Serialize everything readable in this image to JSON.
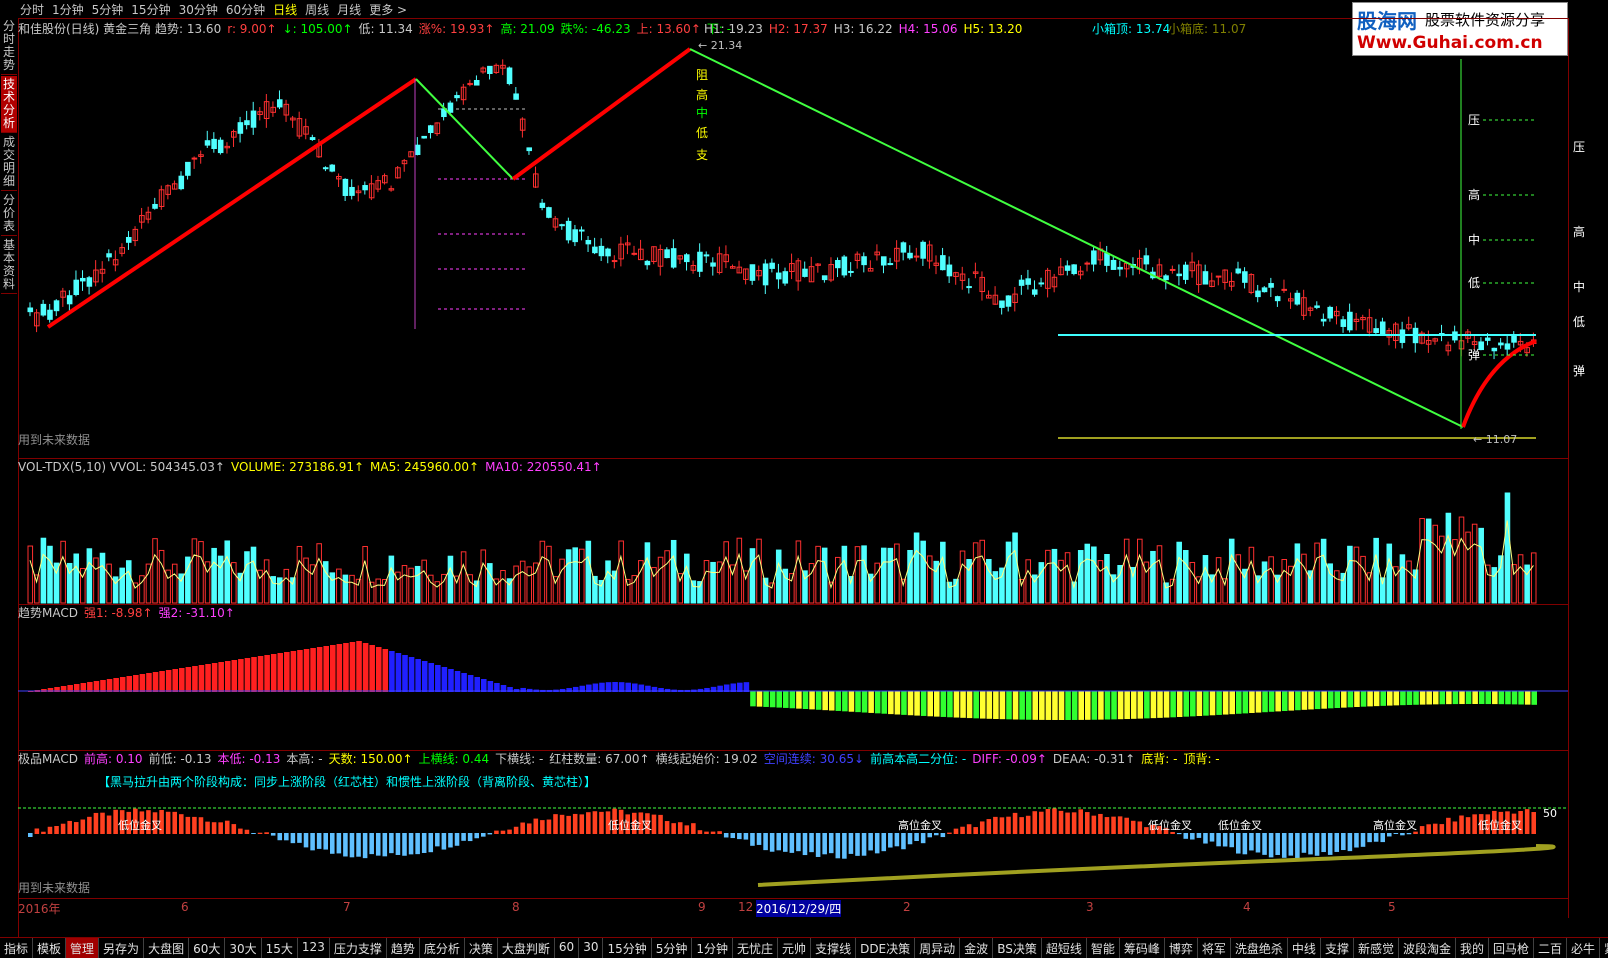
{
  "topbar": {
    "tabs": [
      "分时",
      "1分钟",
      "5分钟",
      "15分钟",
      "30分钟",
      "60分钟",
      "日线",
      "周线",
      "月线",
      "更多 >"
    ],
    "active_index": 6
  },
  "left_tabs": [
    "分时走势",
    "技术分析",
    "成交明细",
    "分价表",
    "基本资料"
  ],
  "left_active_index": 1,
  "logo": {
    "title": "股海网",
    "subtitle": "股票软件资源分享",
    "url": "Www.Guhai.com.cn"
  },
  "main": {
    "legend": [
      {
        "text": "和佳股份(日线) 黄金三角  趋势: 13.60",
        "color": "#c8c8c8"
      },
      {
        "text": "r: 9.00↑",
        "color": "#ff4040"
      },
      {
        "text": "↓: 105.00↑",
        "color": "#00ff00"
      },
      {
        "text": "低: 11.34",
        "color": "#c8c8c8"
      },
      {
        "text": "涨%: 19.93↑",
        "color": "#ff4040"
      },
      {
        "text": "高: 21.09",
        "color": "#00ff00"
      },
      {
        "text": "跌%: -46.23",
        "color": "#00ff00"
      },
      {
        "text": "上: 13.60↑",
        "color": "#ff4040"
      },
      {
        "text": "下: -",
        "color": "#00ff00"
      }
    ],
    "h_legend": [
      {
        "text": "H1: 19.23",
        "color": "#c8c8c8"
      },
      {
        "text": "H2: 17.37",
        "color": "#ff4040"
      },
      {
        "text": "H3: 16.22",
        "color": "#c8c8c8"
      },
      {
        "text": "H4: 15.06",
        "color": "#ff40ff"
      },
      {
        "text": "H5: 13.20",
        "color": "#ffff00"
      }
    ],
    "box_top": "小箱顶: 13.74",
    "box_bottom": "小箱底: 11.07",
    "peak_label": "21.34",
    "low_label": "11.07",
    "future_note": "用到未来数据",
    "level_labels_left": [
      "阻",
      "高",
      "中",
      "低",
      "支"
    ],
    "level_labels_right": [
      "压",
      "高",
      "中",
      "低",
      "弹"
    ]
  },
  "vol": {
    "legend": [
      {
        "text": "VOL-TDX(5,10)  VVOL: 504345.03↑",
        "color": "#c8c8c8"
      },
      {
        "text": "VOLUME: 273186.91↑",
        "color": "#ffff00"
      },
      {
        "text": "MA5: 245960.00↑",
        "color": "#ffff00"
      },
      {
        "text": "MA10: 220550.41↑",
        "color": "#ff40ff"
      }
    ]
  },
  "macd1": {
    "legend": [
      {
        "text": "趋势MACD",
        "color": "#c8c8c8"
      },
      {
        "text": "强1: -8.98↑",
        "color": "#ff4040"
      },
      {
        "text": "强2: -31.10↑",
        "color": "#ff40ff"
      }
    ]
  },
  "macd2": {
    "legend": [
      {
        "text": "极品MACD",
        "color": "#c8c8c8"
      },
      {
        "text": "前高: 0.10",
        "color": "#ff40ff"
      },
      {
        "text": "前低: -0.13",
        "color": "#c8c8c8"
      },
      {
        "text": "本低: -0.13",
        "color": "#ff40ff"
      },
      {
        "text": "本高: -",
        "color": "#c8c8c8"
      },
      {
        "text": "天数: 150.00↑",
        "color": "#ffff00"
      },
      {
        "text": "上横线: 0.44",
        "color": "#00ff00"
      },
      {
        "text": "下横线: -",
        "color": "#c8c8c8"
      },
      {
        "text": "红柱数量: 67.00↑",
        "color": "#c8c8c8"
      },
      {
        "text": "横线起始价: 19.02",
        "color": "#c8c8c8"
      },
      {
        "text": "空间连续: 30.65↓",
        "color": "#4040ff"
      },
      {
        "text": "前高本高二分位: -",
        "color": "#00ffff"
      },
      {
        "text": "DIFF: -0.09↑",
        "color": "#ff40ff"
      },
      {
        "text": "DEAA: -0.31↑",
        "color": "#c8c8c8"
      },
      {
        "text": "底背: -",
        "color": "#ffff00"
      },
      {
        "text": "顶背: -",
        "color": "#ffff00"
      }
    ],
    "banner": "【黑马拉升由两个阶段构成：同步上涨阶段（红芯柱）和惯性上涨阶段（背离阶段、黄芯柱）】",
    "annotations": [
      "低位金叉",
      "低位金叉",
      "高位金叉",
      "低位金叉",
      "低位金叉",
      "高位金叉",
      "低位金叉"
    ],
    "future_note": "用到未来数据",
    "right_value": "50"
  },
  "date_axis": {
    "labels": [
      "2016年",
      "6",
      "7",
      "8",
      "9",
      "12",
      "2016/12/29/四",
      "2",
      "3",
      "4",
      "5"
    ]
  },
  "right_scale": [
    "压",
    "高",
    "中",
    "低",
    "弹"
  ],
  "bottombar": [
    "指标",
    "模板",
    "管理",
    "另存为",
    "大盘图",
    "60大",
    "30大",
    "15大",
    "123",
    "压力支撑",
    "趋势",
    "底分析",
    "决策",
    "大盘判断",
    "60",
    "30",
    "15分钟",
    "5分钟",
    "1分钟",
    "无忧庄",
    "元帅",
    "支撑线",
    "DDE决策",
    "周异动",
    "金波",
    "BS决策",
    "超短线",
    "智能",
    "筹码峰",
    "博弈",
    "将军",
    "洗盘绝杀",
    "中线",
    "支撑",
    "新感觉",
    "波段淘金",
    "我的",
    "回马枪",
    "二百",
    "必牛",
    "紧盯"
  ],
  "colors": {
    "up": "#ff3030",
    "down": "#50ffff",
    "trend_up": "#ff0000",
    "trend_down": "#40ff40",
    "border": "#800000"
  }
}
